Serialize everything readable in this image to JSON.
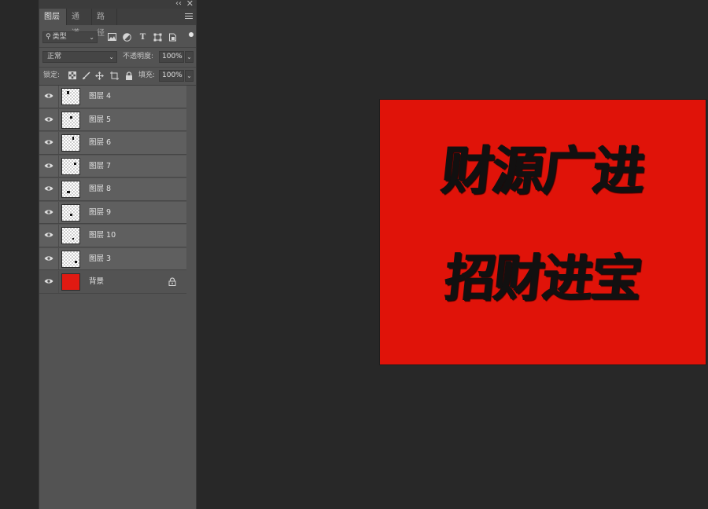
{
  "panel": {
    "collapse_glyph": "‹‹",
    "close_glyph": "✕",
    "tabs": [
      {
        "label": "图层",
        "active": true
      },
      {
        "label": "通道",
        "active": false
      },
      {
        "label": "路径",
        "active": false
      }
    ],
    "filter": {
      "kind_label": "类型",
      "icons": [
        "image-filter-icon",
        "adjustment-filter-icon",
        "type-filter-icon",
        "shape-filter-icon",
        "smart-object-filter-icon"
      ]
    },
    "blend": {
      "mode": "正常",
      "opacity_label": "不透明度:",
      "opacity_value": "100%"
    },
    "lock": {
      "label": "锁定:",
      "fill_label": "填充:",
      "fill_value": "100%"
    },
    "layers": [
      {
        "name": "图层 4",
        "thumb": "transparent"
      },
      {
        "name": "图层 5",
        "thumb": "transparent"
      },
      {
        "name": "图层 6",
        "thumb": "transparent"
      },
      {
        "name": "图层 7",
        "thumb": "transparent"
      },
      {
        "name": "图层 8",
        "thumb": "transparent"
      },
      {
        "name": "图层 9",
        "thumb": "transparent"
      },
      {
        "name": "图层 10",
        "thumb": "transparent"
      },
      {
        "name": "图层 3",
        "thumb": "transparent"
      },
      {
        "name": "背景",
        "thumb": "red",
        "locked": true
      }
    ]
  },
  "canvas": {
    "background_color": "#e01309",
    "line1": "财源广进",
    "line2": "招财进宝"
  }
}
